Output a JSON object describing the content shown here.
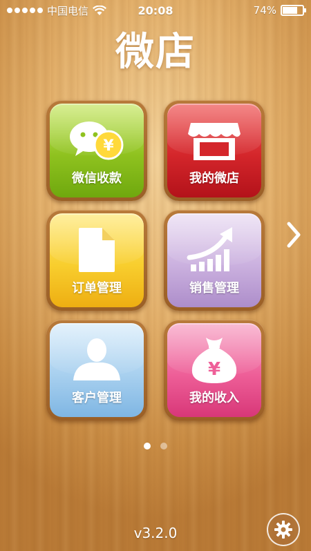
{
  "status_bar": {
    "carrier": "中国电信",
    "time": "20:08",
    "battery_text": "74%",
    "battery_level": 0.74,
    "signal_bars": 5
  },
  "app": {
    "title": "微店"
  },
  "tiles": [
    {
      "label": "微信收款",
      "icon": "wechat-pay-icon",
      "color": "#8fc21f"
    },
    {
      "label": "我的微店",
      "icon": "store-icon",
      "color": "#d4262b"
    },
    {
      "label": "订单管理",
      "icon": "document-icon",
      "color": "#f8ce2e"
    },
    {
      "label": "销售管理",
      "icon": "sales-chart-icon",
      "color": "#cbb1df"
    },
    {
      "label": "客户管理",
      "icon": "customer-icon",
      "color": "#a8d0ef"
    },
    {
      "label": "我的收入",
      "icon": "money-bag-icon",
      "color": "#ee5f98"
    }
  ],
  "pager": {
    "current": 1,
    "total": 2
  },
  "footer": {
    "version": "v3.2.0",
    "settings_icon": "gear-icon"
  }
}
